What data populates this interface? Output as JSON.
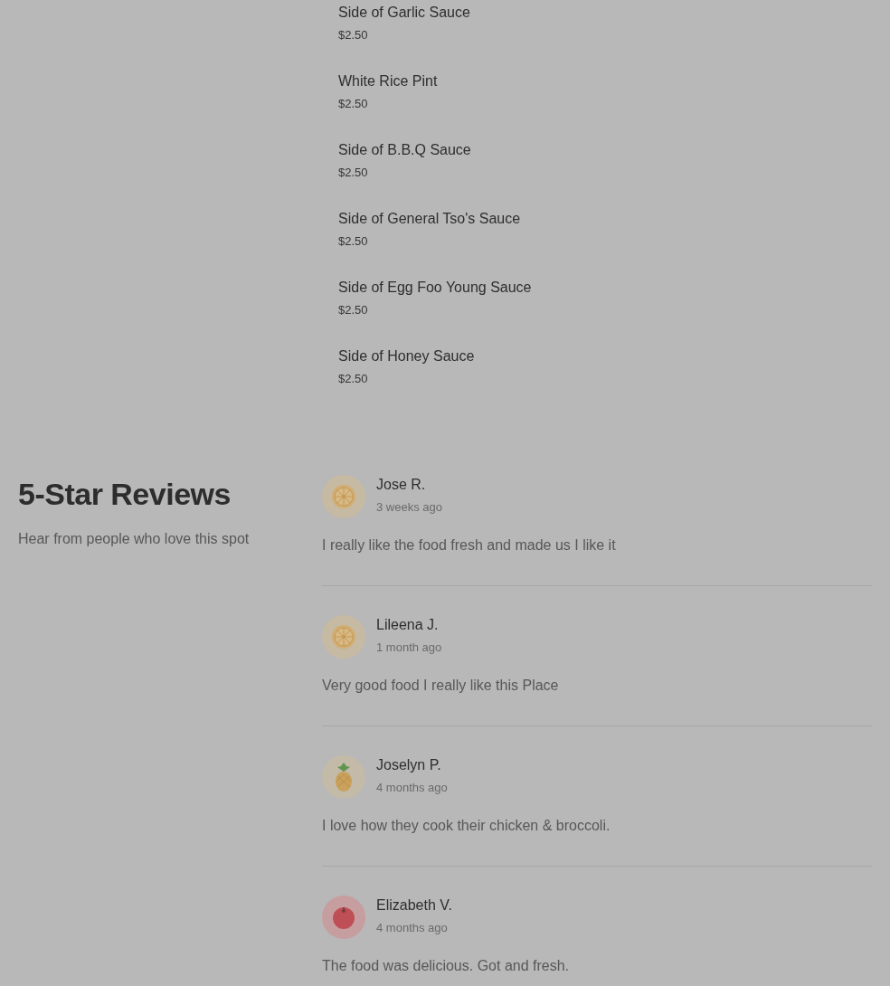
{
  "menu_items": [
    {
      "name": "Side of Garlic Sauce",
      "price": "$2.50"
    },
    {
      "name": "White Rice Pint",
      "price": "$2.50"
    },
    {
      "name": "Side of B.B.Q Sauce",
      "price": "$2.50"
    },
    {
      "name": "Side of General Tso's Sauce",
      "price": "$2.50"
    },
    {
      "name": "Side of Egg Foo Young Sauce",
      "price": "$2.50"
    },
    {
      "name": "Side of Honey Sauce",
      "price": "$2.50"
    }
  ],
  "reviews_section": {
    "title": "5-Star Reviews",
    "subtitle": "Hear from people who love this spot"
  },
  "reviews": [
    {
      "avatar": {
        "kind": "citrus"
      },
      "name": "Jose R.",
      "time": "3 weeks ago",
      "text": "I really like the food fresh and made us I like it"
    },
    {
      "avatar": {
        "kind": "citrus"
      },
      "name": "Lileena J.",
      "time": "1 month ago",
      "text": "Very good food I really like this Place"
    },
    {
      "avatar": {
        "kind": "pineapple"
      },
      "name": "Joselyn P.",
      "time": "4 months ago",
      "text": "I love how they cook their chicken & broccoli."
    },
    {
      "avatar": {
        "kind": "tomato"
      },
      "name": "Elizabeth V.",
      "time": "4 months ago",
      "text": "The food was delicious. Got and fresh."
    }
  ]
}
